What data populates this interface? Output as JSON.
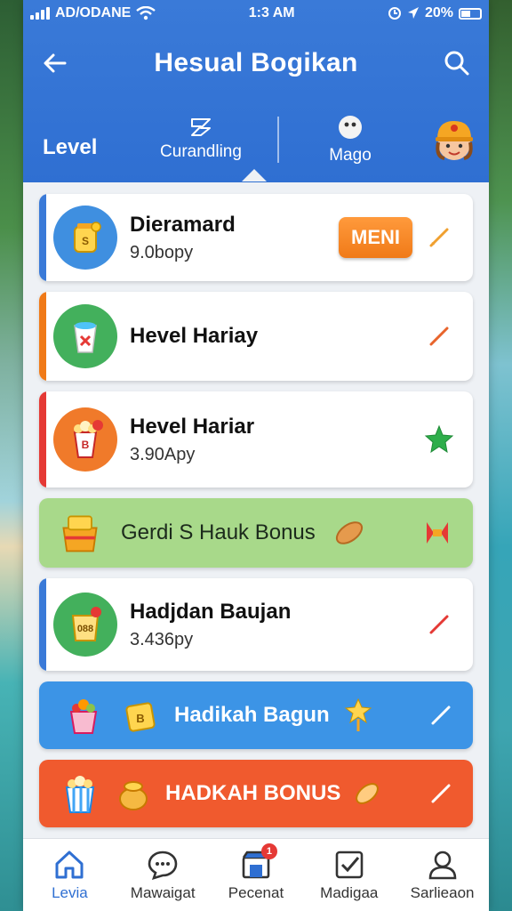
{
  "status_bar": {
    "carrier": "AD/ODANE",
    "time": "1:3 AM",
    "battery": "20%"
  },
  "header": {
    "title": "Hesual Bogikan"
  },
  "tabs": {
    "level": "Level",
    "current": "Curandling",
    "magg": "Mago"
  },
  "cards": [
    {
      "name": "Dieramard",
      "sub": "9.0bopy",
      "badge": "MENI",
      "stripe": "#3a7ad8"
    },
    {
      "name": "Hevel Hariay",
      "sub": "",
      "stripe": "#f07a18"
    },
    {
      "name": "Hevel Hariar",
      "sub": "3.90Apy",
      "stripe": "#e53935"
    },
    {
      "name": "Hadjdan Baujan",
      "sub": "3.436py",
      "stripe": "#3a7ad8"
    }
  ],
  "banners": {
    "green": "Gerdi S Hauk Bonus",
    "blue": "Hadikah Bagun",
    "orange": "HADKAH BONUS"
  },
  "colors": {
    "primary": "#2f6fd2",
    "orange": "#f07a18",
    "green_banner": "#a8d98a",
    "blue_banner": "#3c94e6",
    "orange_banner": "#f05a2e"
  },
  "nav": [
    {
      "label": "Levia",
      "icon": "home-icon"
    },
    {
      "label": "Mawaigat",
      "icon": "chat-icon"
    },
    {
      "label": "Pecenat",
      "icon": "shop-icon",
      "badge": "1"
    },
    {
      "label": "Madigaa",
      "icon": "checkbox-icon"
    },
    {
      "label": "Sarlieaon",
      "icon": "profile-icon"
    }
  ]
}
